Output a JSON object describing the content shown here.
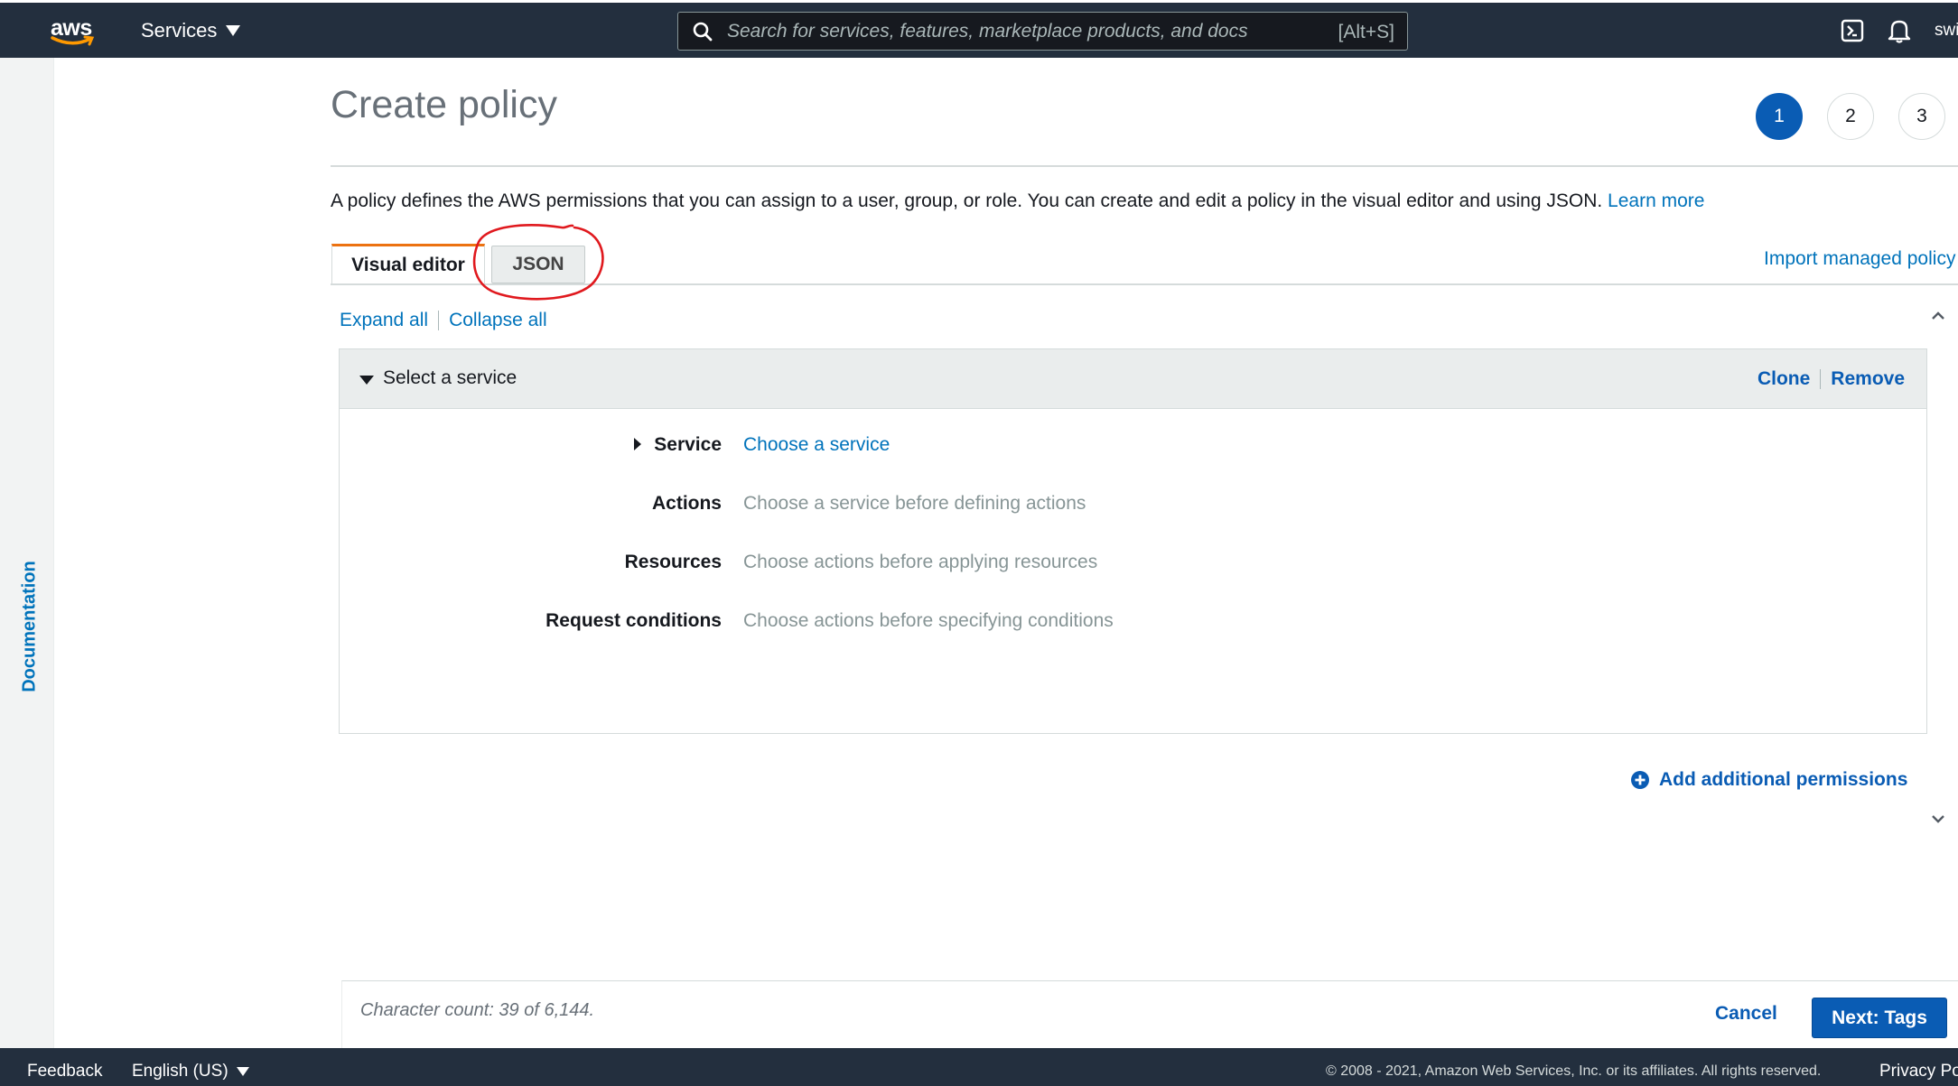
{
  "topbar": {
    "logo_text": "aws",
    "services_label": "Services",
    "search_placeholder": "Search for services, features, marketplace products, and docs",
    "search_shortcut": "[Alt+S]",
    "account_name": "swi"
  },
  "side_panel": {
    "label": "Documentation"
  },
  "header": {
    "title": "Create policy",
    "steps": [
      "1",
      "2",
      "3"
    ],
    "active_step": 1
  },
  "description": {
    "text": "A policy defines the AWS permissions that you can assign to a user, group, or role. You can create and edit a policy in the visual editor and using JSON.",
    "learn_more": "Learn more"
  },
  "tabs": {
    "visual_editor": "Visual editor",
    "json": "JSON",
    "import_link": "Import managed policy"
  },
  "controls": {
    "expand_all": "Expand all",
    "collapse_all": "Collapse all"
  },
  "statement": {
    "title": "Select a service",
    "clone": "Clone",
    "remove": "Remove",
    "rows": [
      {
        "label": "Service",
        "value": "Choose a service"
      },
      {
        "label": "Actions",
        "value": "Choose a service before defining actions"
      },
      {
        "label": "Resources",
        "value": "Choose actions before applying resources"
      },
      {
        "label": "Request conditions",
        "value": "Choose actions before specifying conditions"
      }
    ]
  },
  "add_permissions": "Add additional permissions",
  "action_bar": {
    "char_count": "Character count: 39 of 6,144.",
    "cancel": "Cancel",
    "next": "Next: Tags"
  },
  "footer": {
    "feedback": "Feedback",
    "language": "English (US)",
    "copyright": "© 2008 - 2021, Amazon Web Services, Inc. or its affiliates. All rights reserved.",
    "privacy": "Privacy Po"
  },
  "colors": {
    "nav_bg": "#232f3e",
    "link": "#0073bb",
    "primary": "#0a5cb4",
    "tab_accent": "#ec7211",
    "annotation": "#e0191e"
  }
}
